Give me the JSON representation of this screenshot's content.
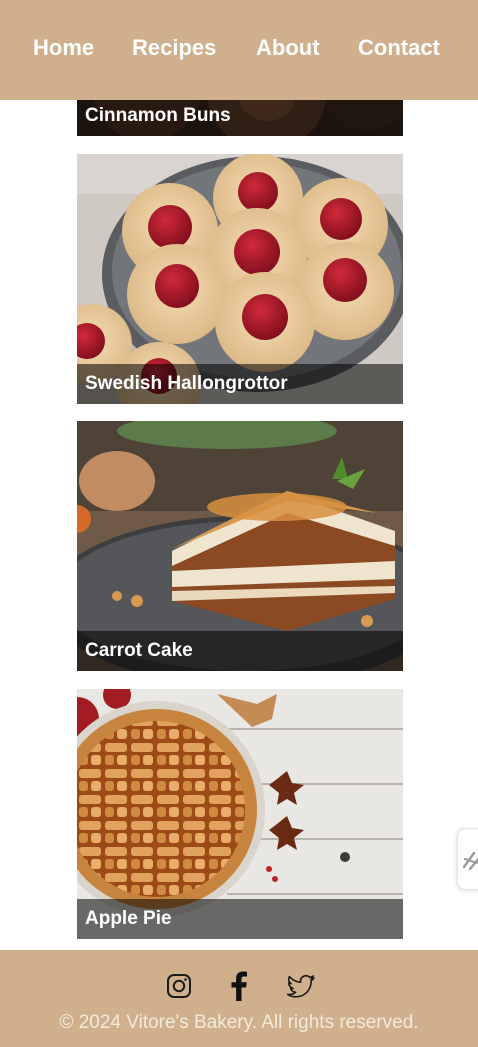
{
  "nav": {
    "items": [
      "Home",
      "Recipes",
      "About",
      "Contact"
    ]
  },
  "recipes": [
    {
      "title": "Cinnamon Buns",
      "image": "cinnamon-buns-photo"
    },
    {
      "title": "Swedish Hallongrottor",
      "image": "thumbprint-cookies-photo"
    },
    {
      "title": "Carrot Cake",
      "image": "carrot-cake-slice-photo"
    },
    {
      "title": "Apple Pie",
      "image": "lattice-apple-pie-photo"
    }
  ],
  "footer": {
    "social": [
      "instagram-icon",
      "facebook-icon",
      "twitter-icon"
    ],
    "copyright": "© 2024 Vitore's Bakery. All rights reserved."
  },
  "colors": {
    "header_bg": "#d0b08c",
    "footer_bg": "#d0b08c",
    "nav_text": "#ffffff",
    "caption_overlay": "rgba(0,0,0,0.55)"
  }
}
